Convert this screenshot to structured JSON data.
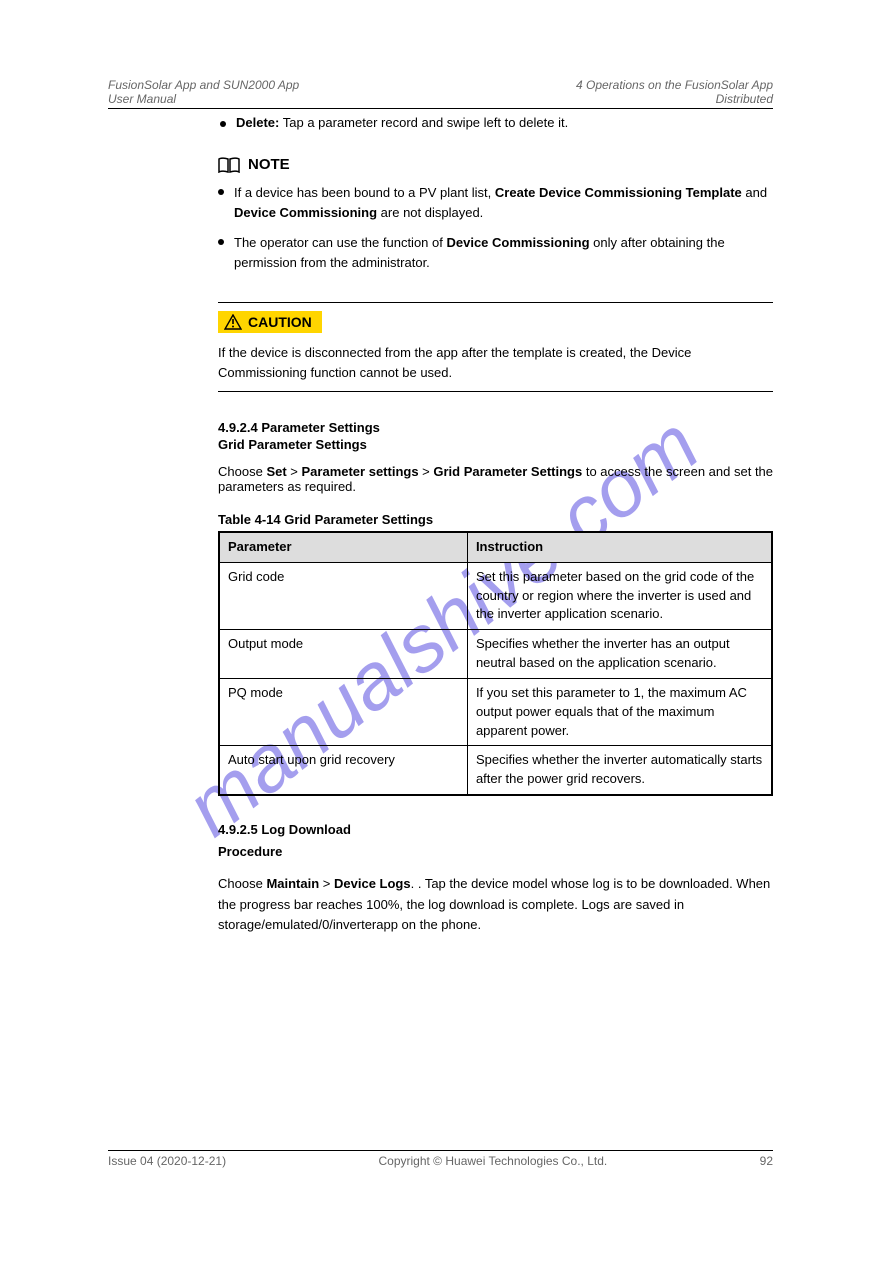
{
  "header": {
    "product": "FusionSolar App and SUN2000 App",
    "doc": "User Manual",
    "section_no": "4 Operations on the FusionSolar App",
    "section_label": "Distributed"
  },
  "body": {
    "bullet1_label": "Delete:",
    "bullet1_text": "Tap a parameter record and swipe left to delete it.",
    "note_prefix": "If a device has been bound to a PV plant list,",
    "note_b1": "Create Device Commissioning Template",
    "note_mid1": "and",
    "note_b2": "Device Commissioning",
    "note_suffix": "are not displayed.",
    "note2_prefix": "The operator can use the function of",
    "note2_suffix": "only after obtaining the permission from the administrator.",
    "caution_text": "If the device is disconnected from the app after the template is created, the Device Commissioning function cannot be used.",
    "sec4_no": "4.9.2.4 Parameter Settings",
    "sec4_sub": "Grid Parameter Settings",
    "sec4_desc_prefix": "Choose",
    "sec4_desc_b1": "Set",
    "sec4_desc_b2": "Parameter settings",
    "sec4_desc_b3": "Grid Parameter Settings",
    "sec4_desc_suffix": "to access the screen and set the parameters as required.",
    "sec5_no": "4.9.2.5 Log Download",
    "sec5_sub": "Procedure",
    "sec5_body_prefix": "Choose",
    "sec5_body_b1": "Maintain",
    "sec5_body_b2": "Device Logs",
    "sec5_body_suffix": ". Tap the device model whose log is to be downloaded. When the progress bar reaches 100%, the log download is complete. Logs are saved in\nstorage/emulated/0/inverterapp on the phone."
  },
  "table": {
    "caption": "Table 4-14 Grid Parameter Settings",
    "header": [
      "Parameter",
      "Instruction"
    ],
    "rows": [
      [
        "Grid code",
        "Set this parameter based on the grid code of the country or region where the inverter is used and the inverter application scenario."
      ],
      [
        "Output mode",
        "Specifies whether the inverter has an output neutral based on the application scenario."
      ],
      [
        "PQ mode",
        "If you set this parameter to 1, the maximum AC output power equals that of the maximum apparent power."
      ],
      [
        "Auto start upon grid recovery",
        "Specifies whether the inverter automatically starts after the power grid recovers."
      ]
    ]
  },
  "footer": {
    "issue": "Issue 04 (2020-12-21)",
    "copyright": "Copyright © Huawei Technologies Co., Ltd.",
    "page": "92"
  },
  "watermark_text": "manualshive.com"
}
